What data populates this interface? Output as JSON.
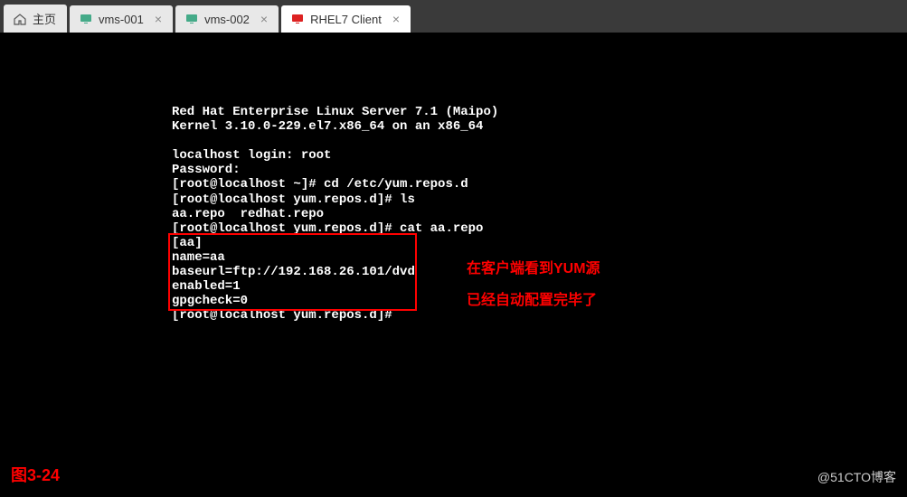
{
  "tabs": {
    "home": "主页",
    "vm1": "vms-001",
    "vm2": "vms-002",
    "active": "RHEL7 Client",
    "close_glyph": "×"
  },
  "terminal": {
    "line1": "Red Hat Enterprise Linux Server 7.1 (Maipo)",
    "line2": "Kernel 3.10.0-229.el7.x86_64 on an x86_64",
    "line3": "",
    "line4": "localhost login: root",
    "line5": "Password:",
    "line6": "[root@localhost ~]# cd /etc/yum.repos.d",
    "line7": "[root@localhost yum.repos.d]# ls",
    "line8": "aa.repo  redhat.repo",
    "line9": "[root@localhost yum.repos.d]# cat aa.repo",
    "line10": "[aa]",
    "line11": "name=aa",
    "line12": "baseurl=ftp://192.168.26.101/dvd",
    "line13": "enabled=1",
    "line14": "gpgcheck=0",
    "line15": "[root@localhost yum.repos.d]#"
  },
  "annotation": {
    "line1": "在客户端看到YUM源",
    "line2": "已经自动配置完毕了"
  },
  "figure_label": "图3-24",
  "watermark": "@51CTO博客"
}
